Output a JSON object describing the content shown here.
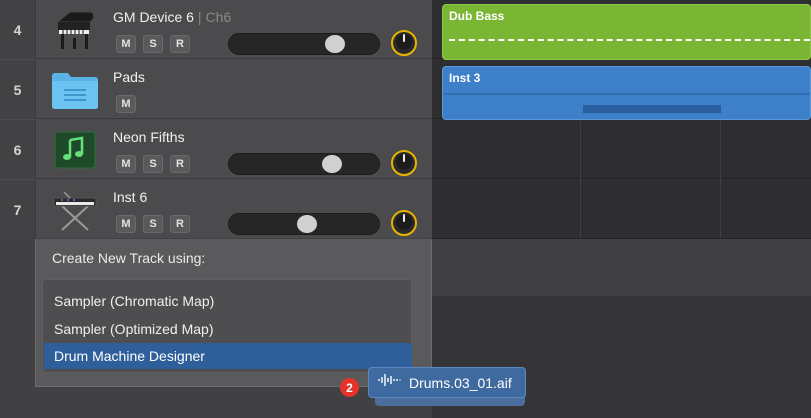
{
  "tracks": [
    {
      "number": "4",
      "name": "GM Device 6",
      "subname": "Ch6",
      "separator": "|",
      "icon": "grand-piano-icon",
      "buttons": [
        "M",
        "S",
        "R"
      ],
      "volume": 0.74
    },
    {
      "number": "5",
      "name": "Pads",
      "icon": "folder-icon",
      "buttons": [
        "M"
      ]
    },
    {
      "number": "6",
      "name": "Neon Fifths",
      "icon": "music-note-icon",
      "buttons": [
        "M",
        "S",
        "R"
      ],
      "volume": 0.72
    },
    {
      "number": "7",
      "name": "Inst 6",
      "icon": "keyboard-stand-icon",
      "buttons": [
        "M",
        "S",
        "R"
      ],
      "volume": 0.52
    }
  ],
  "regions": [
    {
      "label": "Dub Bass",
      "color": "#7ab534"
    },
    {
      "label": "Inst 3",
      "color": "#3d7fc9"
    }
  ],
  "popup": {
    "title": "Create New Track using:",
    "options": [
      {
        "label": "Sampler (Chromatic Map)",
        "selected": false
      },
      {
        "label": "Sampler (Optimized Map)",
        "selected": false
      },
      {
        "label": "Drum Machine Designer",
        "selected": true
      }
    ]
  },
  "drag": {
    "file_label": "Drums.03_01.aif",
    "count_badge": "2",
    "icon": "audio-waveform-icon"
  },
  "colors": {
    "pan_ring": "#e6b400",
    "selection": "#2f5f9a",
    "badge": "#e5332a"
  }
}
